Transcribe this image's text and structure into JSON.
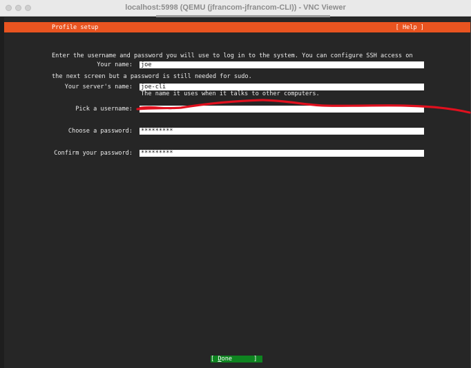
{
  "window": {
    "title": "localhost:5998 (QEMU (jfrancom-jfrancom-CLI)) - VNC Viewer"
  },
  "header": {
    "title": "Profile setup",
    "help": "[ Help ]"
  },
  "intro": {
    "line1": "Enter the username and password you will use to log in to the system. You can configure SSH access on",
    "line2": "the next screen but a password is still needed for sudo."
  },
  "fields": {
    "name": {
      "label": "Your name:",
      "value": "joe"
    },
    "server": {
      "label": "Your server's name:",
      "value": "joe-cli",
      "hint": "The name it uses when it talks to other computers."
    },
    "username": {
      "label": "Pick a username:",
      "value": ""
    },
    "password": {
      "label": "Choose a password:",
      "value": "*********"
    },
    "confirm": {
      "label": "Confirm your password:",
      "value": "*********"
    }
  },
  "done_button": {
    "open": "[ ",
    "mnemonic": "D",
    "rest": "one",
    "close": "      ]"
  },
  "colors": {
    "accent": "#e95420",
    "done": "#0e8420",
    "redaction": "#e0101e"
  }
}
